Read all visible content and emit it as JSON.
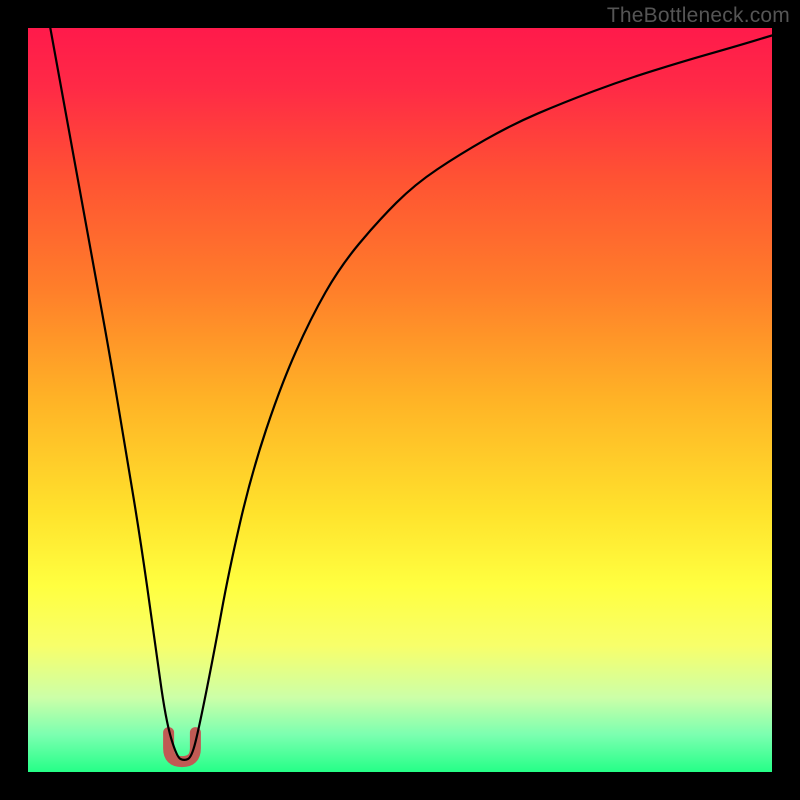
{
  "watermark": "TheBottleneck.com",
  "chart_data": {
    "type": "line",
    "title": "",
    "xlabel": "",
    "ylabel": "",
    "xlim": [
      0,
      100
    ],
    "ylim": [
      0,
      100
    ],
    "background_gradient": {
      "stops": [
        {
          "offset": 0.0,
          "color": "#ff1a4b"
        },
        {
          "offset": 0.08,
          "color": "#ff2a46"
        },
        {
          "offset": 0.2,
          "color": "#ff5233"
        },
        {
          "offset": 0.35,
          "color": "#ff7e2a"
        },
        {
          "offset": 0.5,
          "color": "#ffb326"
        },
        {
          "offset": 0.65,
          "color": "#ffe22c"
        },
        {
          "offset": 0.75,
          "color": "#ffff40"
        },
        {
          "offset": 0.83,
          "color": "#f8ff6a"
        },
        {
          "offset": 0.9,
          "color": "#ccffa8"
        },
        {
          "offset": 0.95,
          "color": "#7bffb0"
        },
        {
          "offset": 1.0,
          "color": "#25ff87"
        }
      ]
    },
    "series": [
      {
        "name": "bottleneck-curve",
        "color": "#000000",
        "stroke_width": 2.2,
        "x": [
          3,
          5,
          7,
          9,
          11,
          13,
          15,
          17,
          18.5,
          20,
          21,
          22,
          23,
          25,
          27,
          30,
          34,
          38,
          42,
          47,
          52,
          58,
          65,
          72,
          80,
          88,
          95,
          100
        ],
        "y": [
          100,
          89,
          78,
          67,
          56,
          44,
          32,
          18,
          7,
          2,
          1.5,
          2,
          6,
          16,
          27,
          40,
          52,
          61,
          68,
          74,
          79,
          83,
          87,
          90,
          93,
          95.5,
          97.5,
          99
        ]
      }
    ],
    "marker": {
      "name": "optimum-marker",
      "color": "#c05a54",
      "x_center": 20.7,
      "x_half_width": 1.8,
      "y_top": 5.3,
      "y_bottom": 1.4,
      "stroke_width": 11
    }
  }
}
